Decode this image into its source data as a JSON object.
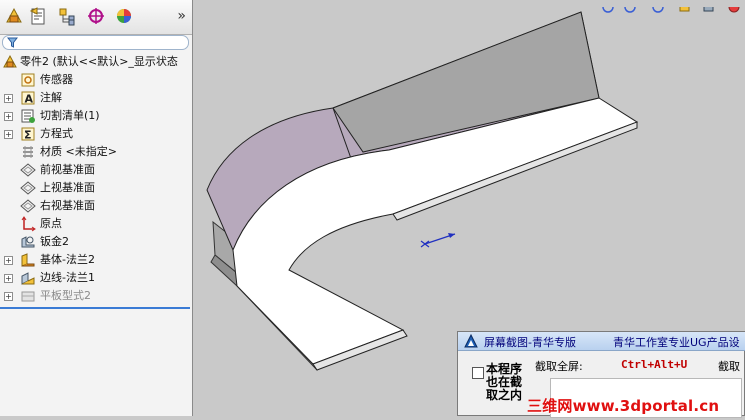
{
  "feature_tree": {
    "root_label": "零件2  (默认<<默认>_显示状态",
    "items": [
      {
        "label": "传感器",
        "icon": "sensor-icon",
        "expandable": false,
        "dim": false
      },
      {
        "label": "注解",
        "icon": "annotation-icon",
        "expandable": true,
        "dim": false
      },
      {
        "label": "切割清单(1)",
        "icon": "cut-list-icon",
        "expandable": true,
        "dim": false
      },
      {
        "label": "方程式",
        "icon": "equation-icon",
        "expandable": true,
        "dim": false
      },
      {
        "label": "材质 <未指定>",
        "icon": "material-icon",
        "expandable": false,
        "dim": false
      },
      {
        "label": "前视基准面",
        "icon": "plane-icon",
        "expandable": false,
        "dim": false
      },
      {
        "label": "上视基准面",
        "icon": "plane-icon",
        "expandable": false,
        "dim": false
      },
      {
        "label": "右视基准面",
        "icon": "plane-icon",
        "expandable": false,
        "dim": false
      },
      {
        "label": "原点",
        "icon": "origin-icon",
        "expandable": false,
        "dim": false
      },
      {
        "label": "钣金2",
        "icon": "sheet-metal-icon",
        "expandable": false,
        "dim": false
      },
      {
        "label": "基体-法兰2",
        "icon": "base-flange-icon",
        "expandable": true,
        "dim": false
      },
      {
        "label": "边线-法兰1",
        "icon": "edge-flange-icon",
        "expandable": true,
        "dim": false
      },
      {
        "label": "平板型式2",
        "icon": "flat-pattern-icon",
        "expandable": true,
        "dim": true
      }
    ]
  },
  "toolbar": {
    "more": "»",
    "tabs": [
      "feature-manager-icon",
      "property-manager-icon",
      "configuration-manager-icon",
      "dimxpert-icon",
      "display-manager-icon"
    ]
  },
  "filter": {
    "icon": "filter-icon"
  },
  "popup": {
    "title": "屏幕截图-青华专版",
    "subtitle": "青华工作室专业UG产品设",
    "note": "本程序也在截取之内",
    "capture_label": "截取全屏:",
    "capture_keys": "Ctrl+Alt+U",
    "capture_label_2": "截取"
  },
  "watermark": "三维网www.3dportal.cn",
  "colors": {
    "panel_bg": "#f3f3f3",
    "viewport_bg": "#c9c9c9",
    "accent": "#3a7bd5",
    "watermark": "#e01010",
    "keys": "#c00000"
  }
}
